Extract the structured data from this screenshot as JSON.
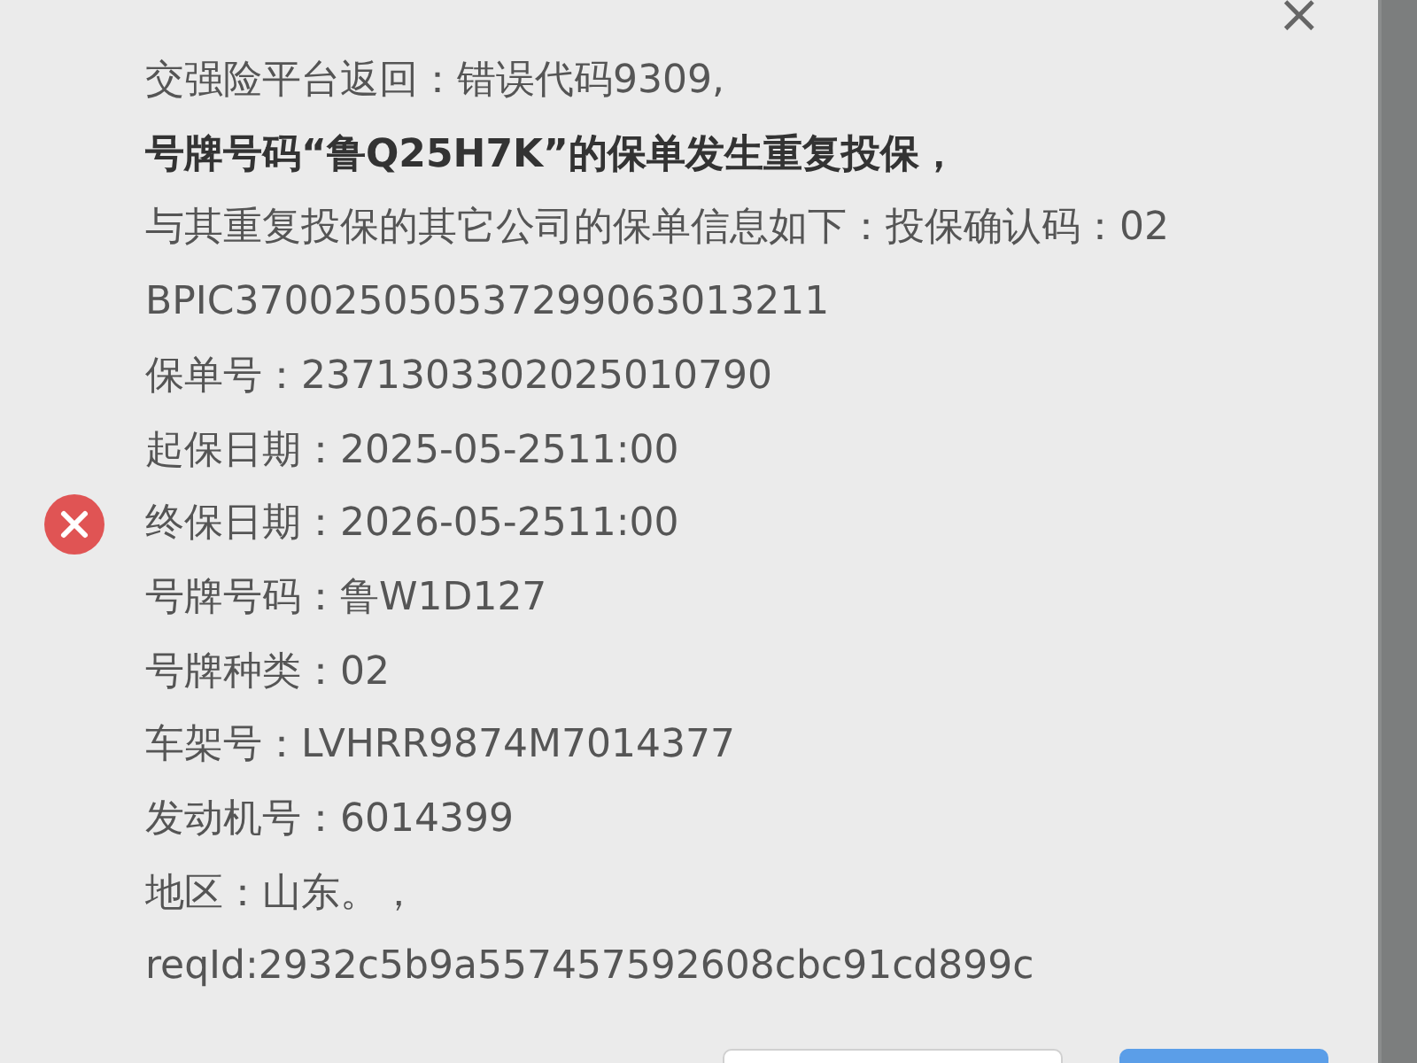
{
  "dialog": {
    "error": true,
    "close": "×",
    "lines": [
      {
        "text": "交强险平台返回：错误代码9309,",
        "bold": false
      },
      {
        "text": "号牌号码“鲁Q25H7K”的保单发生重复投保，",
        "bold": true
      },
      {
        "text": "与其重复投保的其它公司的保单信息如下：投保确认码：02",
        "bold": false
      },
      {
        "text": "BPIC370025050537299063013211",
        "bold": false
      },
      {
        "text": "保单号：2371303302025010790",
        "bold": false
      },
      {
        "text": "起保日期：2025-05-2511:00",
        "bold": false
      },
      {
        "text": "终保日期：2026-05-2511:00",
        "bold": false
      },
      {
        "text": "号牌号码：鲁W1D127",
        "bold": false
      },
      {
        "text": "号牌种类：02",
        "bold": false
      },
      {
        "text": "车架号：LVHRR9874M7014377",
        "bold": false
      },
      {
        "text": "发动机号：6014399",
        "bold": false
      },
      {
        "text": "地区：山东。，",
        "bold": false
      },
      {
        "text": "reqId:2932c5b9a557457592608cbc91cd899c",
        "bold": false
      }
    ],
    "buttons": [
      {
        "kind": "secondary"
      },
      {
        "kind": "primary"
      }
    ]
  }
}
